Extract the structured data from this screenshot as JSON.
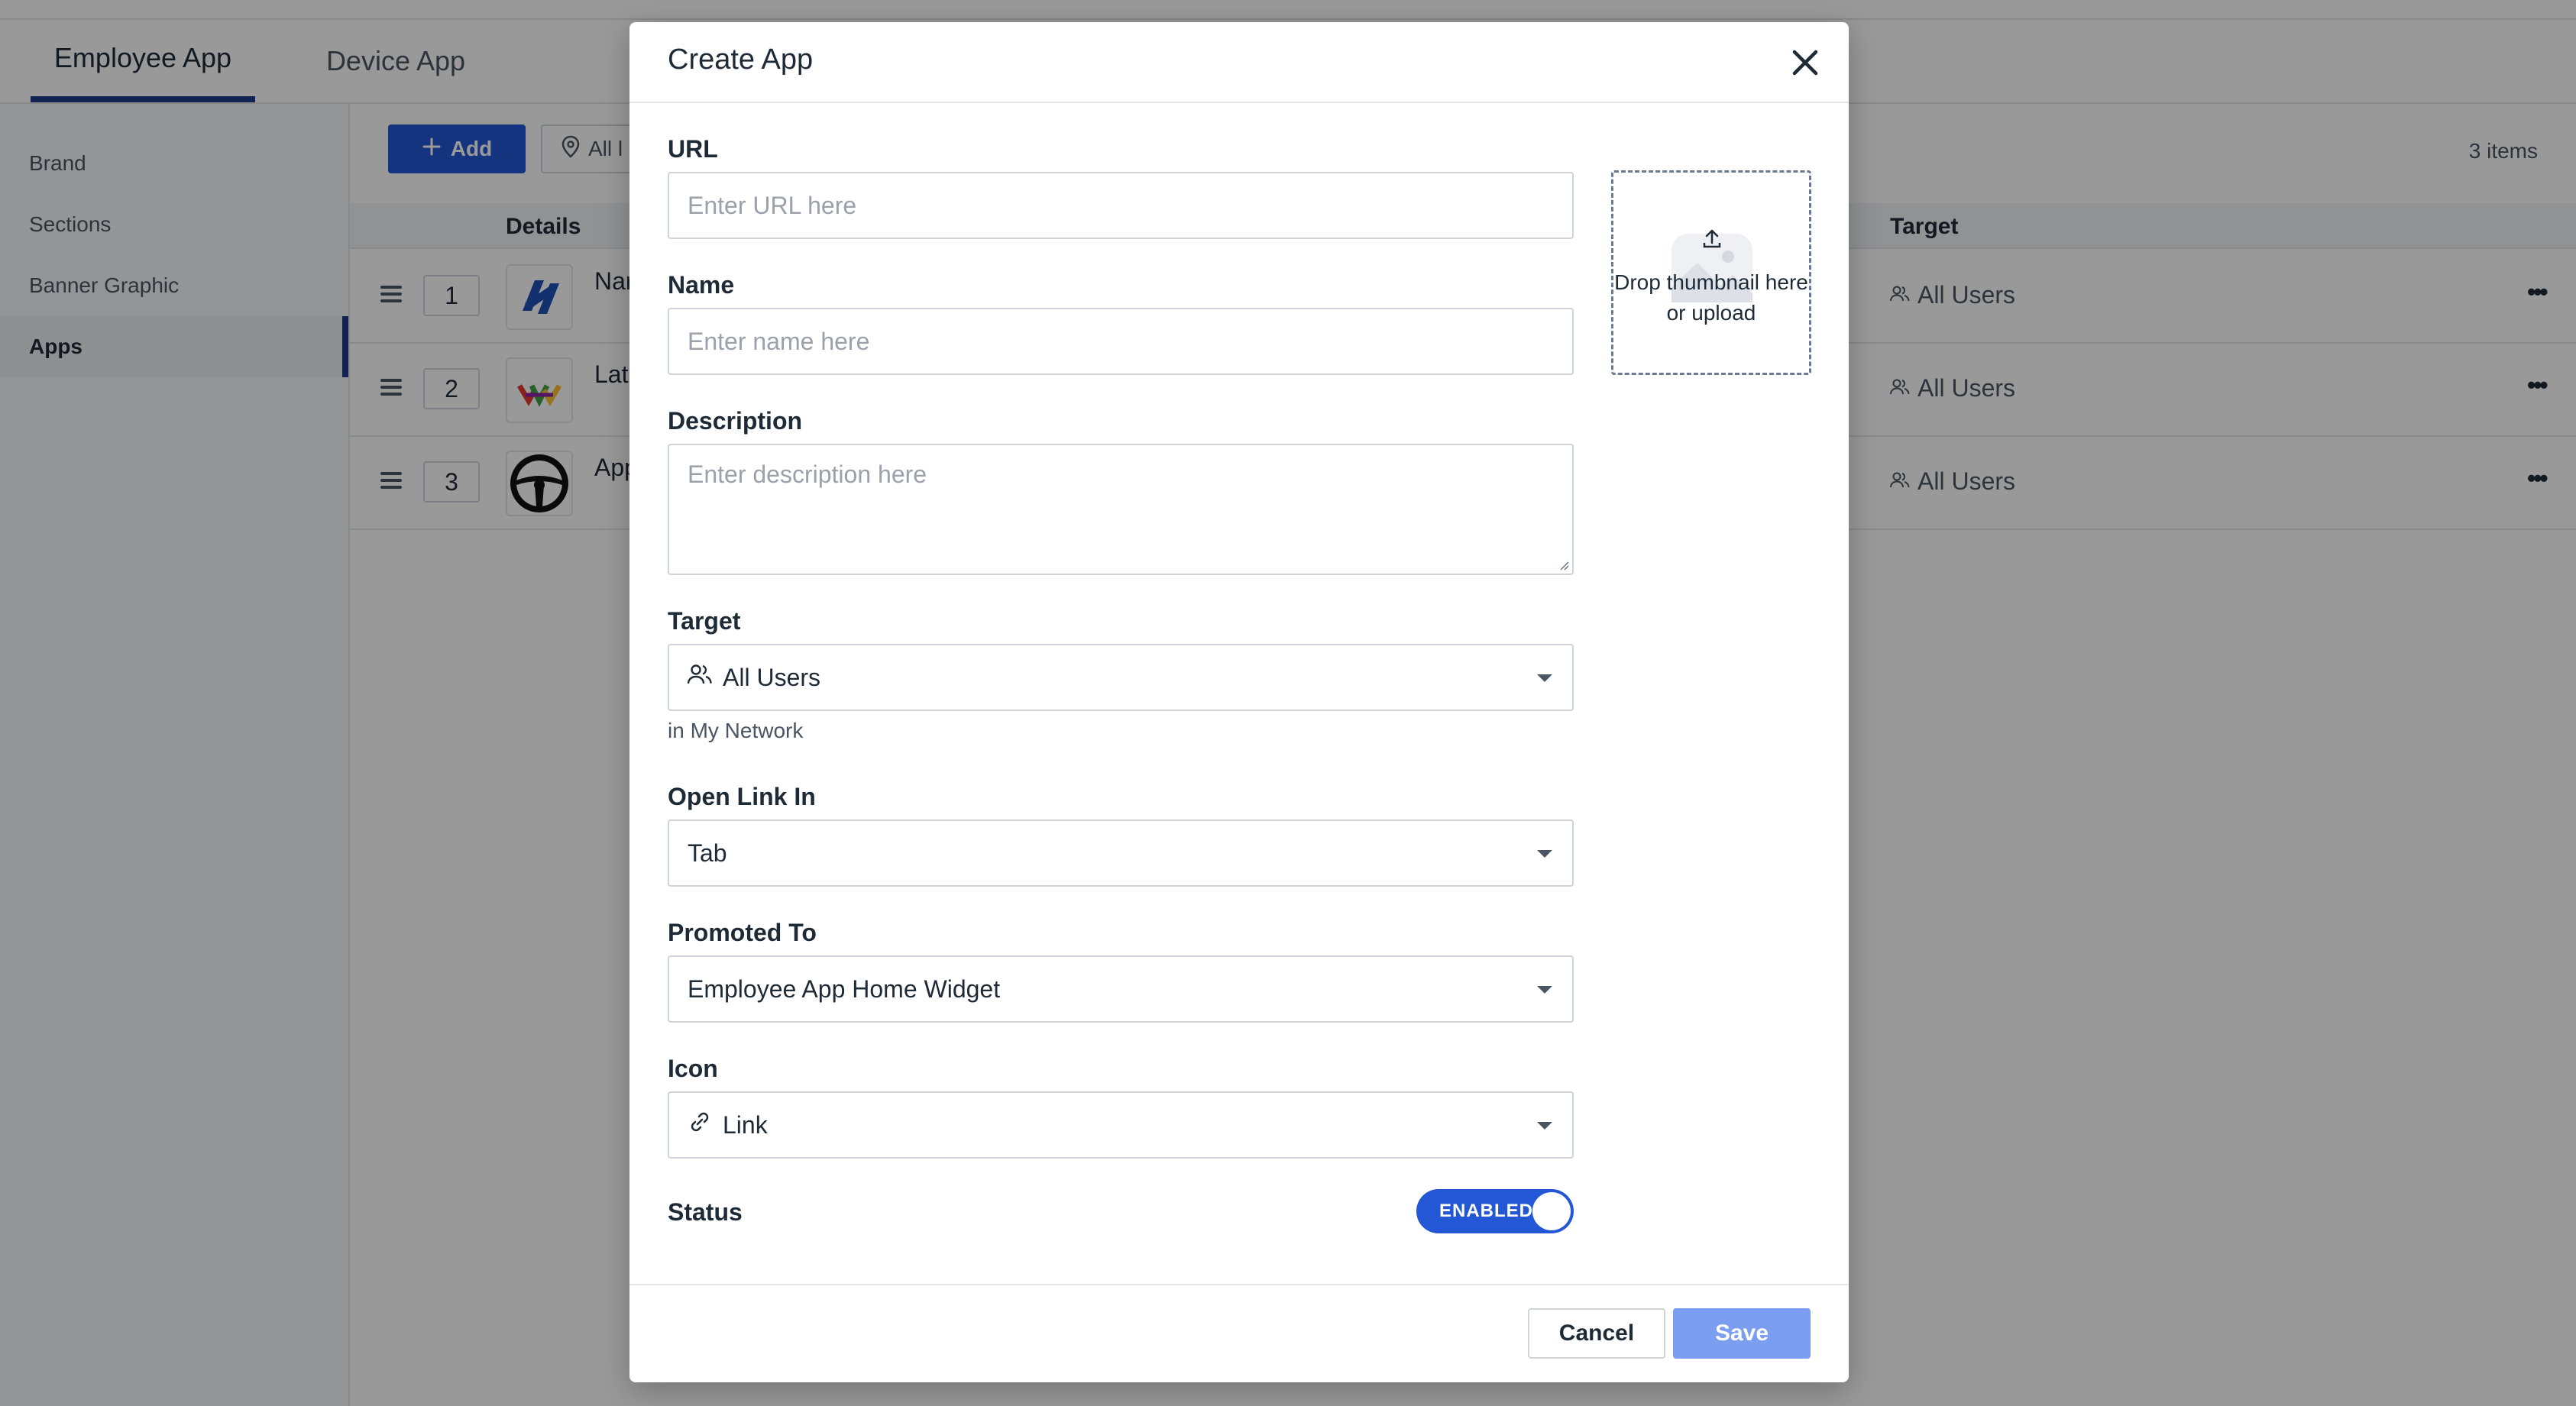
{
  "background": {
    "tabs": [
      {
        "label": "Employee App",
        "active": true
      },
      {
        "label": "Device App",
        "active": false
      }
    ],
    "sidebar": {
      "items": [
        {
          "label": "Brand",
          "active": false
        },
        {
          "label": "Sections",
          "active": false
        },
        {
          "label": "Banner Graphic",
          "active": false
        },
        {
          "label": "Apps",
          "active": true
        }
      ]
    },
    "toolbar": {
      "add_label": "Add",
      "filter_label": "All l",
      "items_count": "3 items"
    },
    "table": {
      "columns": [
        "Details",
        "Target"
      ],
      "rows": [
        {
          "order": "1",
          "name": "Nar",
          "target": "All Users"
        },
        {
          "order": "2",
          "name": "Lat",
          "target": "All Users"
        },
        {
          "order": "3",
          "name": "App",
          "target": "All Users"
        }
      ],
      "more_label": "•••"
    }
  },
  "modal": {
    "title": "Create App",
    "url": {
      "label": "URL",
      "placeholder": "Enter URL here",
      "value": ""
    },
    "name": {
      "label": "Name",
      "placeholder": "Enter name here",
      "value": ""
    },
    "description": {
      "label": "Description",
      "placeholder": "Enter description here",
      "value": ""
    },
    "thumbnail": {
      "text": "Drop thumbnail here or upload"
    },
    "target": {
      "label": "Target",
      "value": "All Users",
      "hint": "in My Network"
    },
    "open_link_in": {
      "label": "Open Link In",
      "value": "Tab"
    },
    "promoted_to": {
      "label": "Promoted To",
      "value": "Employee App Home Widget"
    },
    "icon": {
      "label": "Icon",
      "value": "Link"
    },
    "status": {
      "label": "Status",
      "toggle_label": "ENABLED",
      "enabled": true
    },
    "footer": {
      "cancel_label": "Cancel",
      "save_label": "Save"
    }
  },
  "colors": {
    "accent": "#2457d6",
    "accent_disabled": "#7c9ef0",
    "nav_active": "#1f3a8a"
  }
}
